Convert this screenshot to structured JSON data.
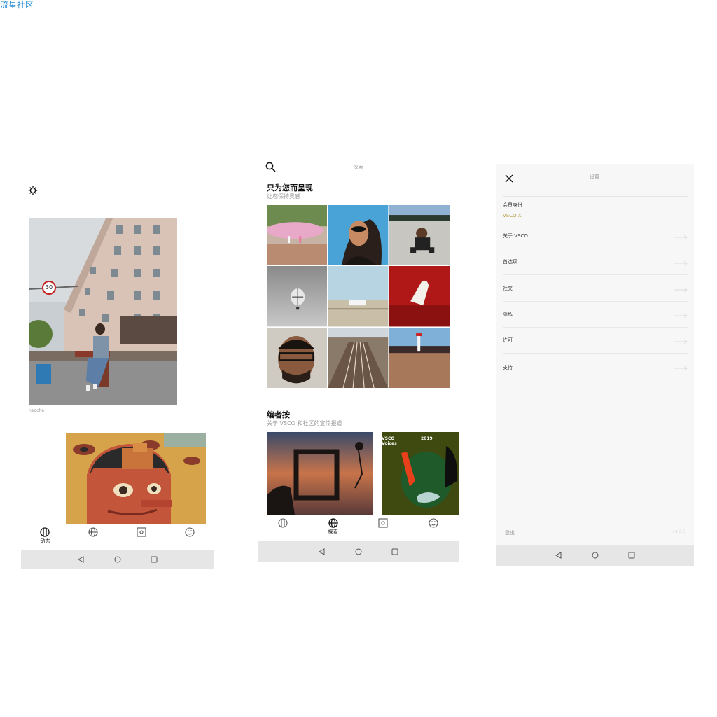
{
  "watermark": "流星社区",
  "feed": {
    "photo_caption": "neocha",
    "speed_sign": "30",
    "tabs": [
      {
        "name": "feed",
        "label": "动态",
        "icon": "feed-icon"
      },
      {
        "name": "explore",
        "label": "",
        "icon": "globe-icon"
      },
      {
        "name": "studio",
        "label": "",
        "icon": "studio-icon"
      },
      {
        "name": "profile",
        "label": "",
        "icon": "face-icon"
      }
    ]
  },
  "explore": {
    "header_title": "探索",
    "section1": {
      "title": "只为您而呈现",
      "subtitle": "让您保持灵感"
    },
    "section2": {
      "title": "编者按",
      "subtitle": "关于 VSCO 和社区的宣传报道"
    },
    "editorial_card": {
      "line1": "VSCO",
      "line2": "Voices",
      "year": "2019"
    },
    "tabs": [
      {
        "name": "feed",
        "label": "",
        "icon": "feed-icon"
      },
      {
        "name": "explore",
        "label": "探索",
        "icon": "globe-icon"
      },
      {
        "name": "studio",
        "label": "",
        "icon": "studio-icon"
      },
      {
        "name": "profile",
        "label": "",
        "icon": "face-icon"
      }
    ]
  },
  "settings": {
    "header_title": "设置",
    "membership_label": "会员身份",
    "membership_value": "VSCO X",
    "items": [
      {
        "label": "关于 VSCO"
      },
      {
        "label": "首选项"
      },
      {
        "label": "社交"
      },
      {
        "label": "隐私"
      },
      {
        "label": "许可"
      },
      {
        "label": "支持"
      }
    ],
    "logout": "登出",
    "version": "v4.2.0"
  },
  "colors": {
    "membership_accent": "#b39a3a",
    "muted": "#999999"
  }
}
